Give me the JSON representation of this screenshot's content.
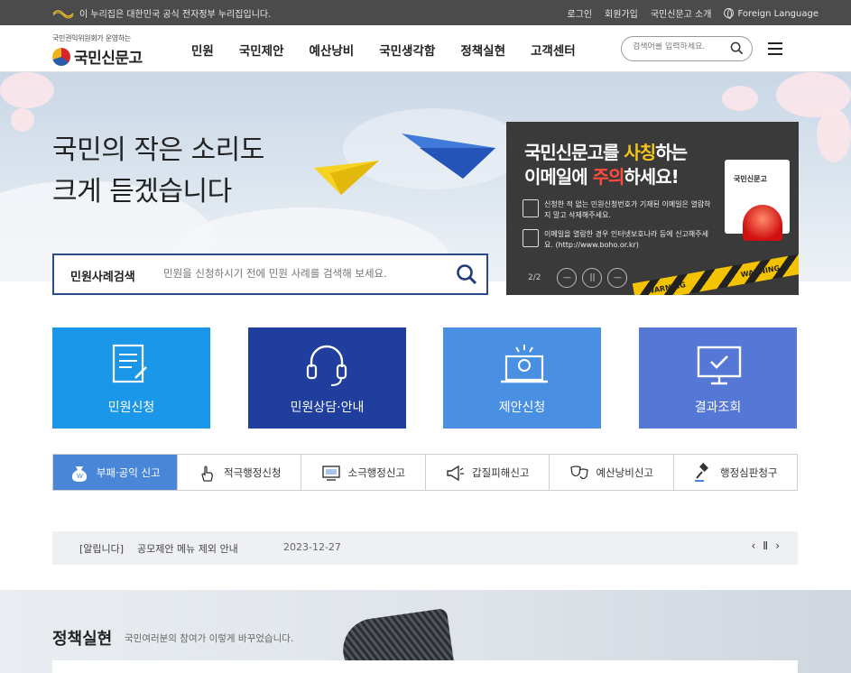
{
  "govbar": {
    "notice": "이 누리집은 대한민국 공식 전자정부 누리집입니다.",
    "links": [
      "로그인",
      "회원가입",
      "국민신문고 소개",
      "Foreign Language"
    ]
  },
  "header": {
    "logo_sub": "국민권익위원회가 운영하는",
    "logo_name": "국민신문고",
    "nav": [
      "민원",
      "국민제안",
      "예산낭비",
      "국민생각함",
      "정책실현",
      "고객센터"
    ],
    "search_placeholder": "검색어를 입력하세요."
  },
  "hero": {
    "title_line1": "국민의 작은 소리도",
    "title_line2": "크게 듣겠습니다",
    "search_label": "민원사례검색",
    "search_placeholder": "민원을 신청하시기 전에 민원 사례를 검색해 보세요."
  },
  "banner": {
    "line1_pre": "국민신문고를 ",
    "line1_hl": "사칭",
    "line1_post": "하는",
    "line2_pre": "이메일에 ",
    "line2_hl": "주의",
    "line2_post": "하세요!",
    "note1": "신청한 적 없는 민원신청번호가 기재된 이메일은 열람하지 말고 삭제해주세요.",
    "note2": "이메일을 열람한 경우 인터넷보호나라 등에 신고해주세요. (http://www.boho.or.kr)",
    "lamp_label": "국민신문고",
    "tape_text": "WARNING",
    "pager": "2/2"
  },
  "tiles": [
    {
      "label": "민원신청",
      "color": "#1a97e8"
    },
    {
      "label": "민원상담·안내",
      "color": "#1f3e9e"
    },
    {
      "label": "제안신청",
      "color": "#4a90e2"
    },
    {
      "label": "결과조회",
      "color": "#5577d6"
    }
  ],
  "reports": [
    "부패·공익 신고",
    "적극행정신청",
    "소극행정신고",
    "갑질피해신고",
    "예산낭비신고",
    "행정심판청구"
  ],
  "notice": {
    "tag": "[알립니다]",
    "text": "공모제안 메뉴 제외 안내",
    "date": "2023-12-27"
  },
  "policy": {
    "title": "정책실현",
    "desc": "국민여러분의 참여가 이렇게 바꾸었습니다."
  }
}
